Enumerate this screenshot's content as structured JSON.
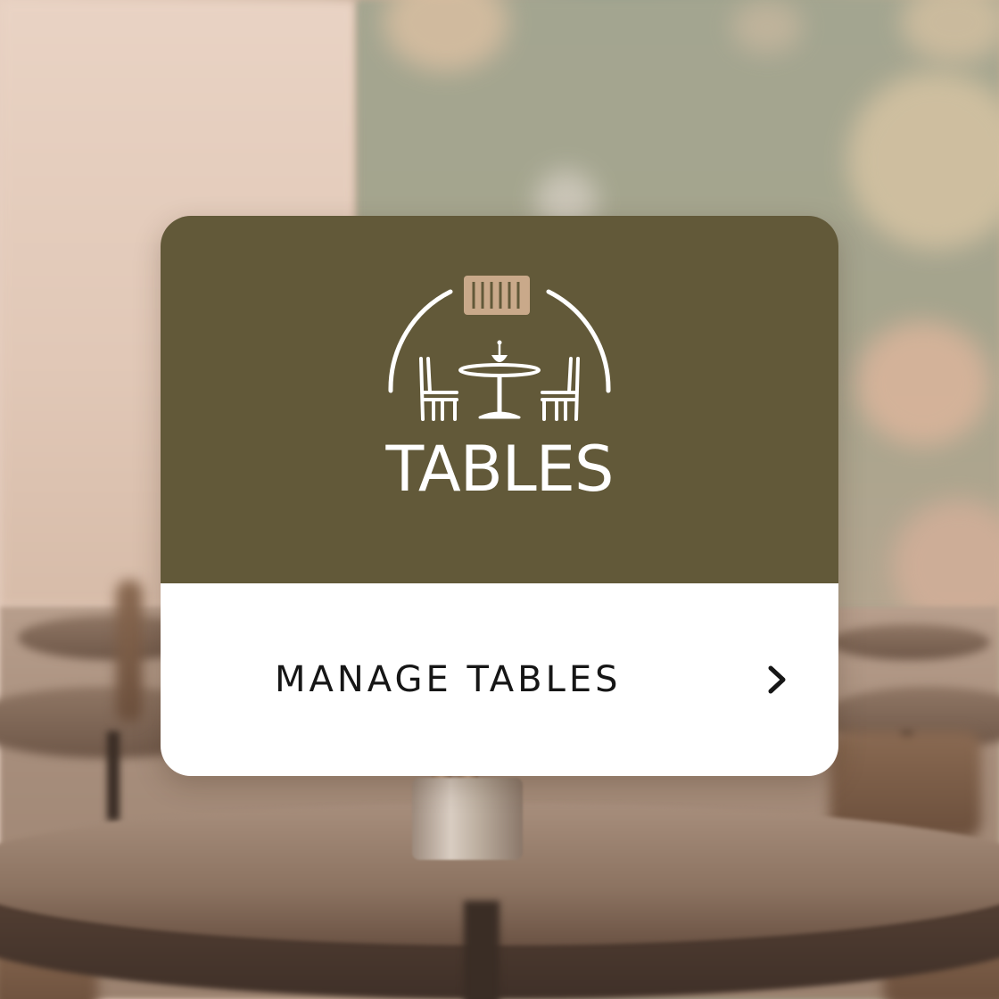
{
  "card": {
    "title": "TABLES",
    "action_label": "MANAGE TABLES"
  },
  "icons": {
    "logo": "dining-table-chairs-icon",
    "chevron": "chevron-right-icon"
  },
  "colors": {
    "card_header": "#625939",
    "card_footer": "#ffffff",
    "logo_accent": "#c9a98a",
    "title_text": "#ffffff",
    "action_text": "#161616"
  }
}
